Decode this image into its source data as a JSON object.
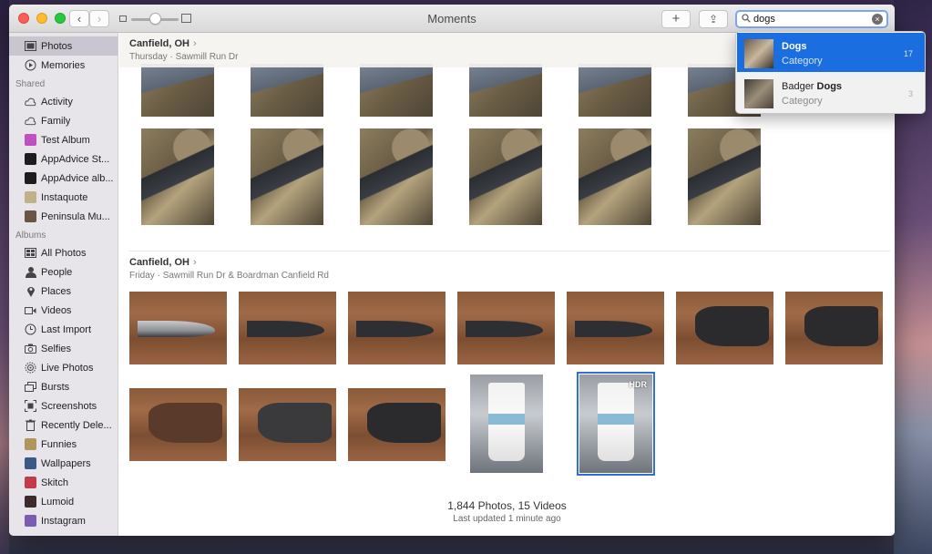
{
  "window": {
    "title": "Moments"
  },
  "toolbar": {
    "back_glyph": "‹",
    "forward_glyph": "›",
    "add_glyph": "+",
    "share_glyph": "⇪"
  },
  "search": {
    "value": "dogs",
    "placeholder": "Search"
  },
  "sidebar": {
    "items": [
      {
        "label": "Photos",
        "icon": "photos-icon",
        "selected": true
      },
      {
        "label": "Memories",
        "icon": "memories-icon"
      }
    ],
    "shared_header": "Shared",
    "shared": [
      {
        "label": "Activity",
        "icon": "cloud-icon"
      },
      {
        "label": "Family",
        "icon": "cloud-icon"
      },
      {
        "label": "Test Album",
        "icon": "album-thumb-icon",
        "color": "#c04fc0"
      },
      {
        "label": "AppAdvice St...",
        "icon": "album-thumb-icon",
        "color": "#1d1d1d"
      },
      {
        "label": "AppAdvice alb...",
        "icon": "album-thumb-icon",
        "color": "#1d1d1d"
      },
      {
        "label": "Instaquote",
        "icon": "album-thumb-icon",
        "color": "#bfb28a"
      },
      {
        "label": "Peninsula Mu...",
        "icon": "album-thumb-icon",
        "color": "#6a5443"
      }
    ],
    "albums_header": "Albums",
    "albums": [
      {
        "label": "All Photos",
        "icon": "all-photos-icon"
      },
      {
        "label": "People",
        "icon": "person-icon"
      },
      {
        "label": "Places",
        "icon": "pin-icon"
      },
      {
        "label": "Videos",
        "icon": "video-icon"
      },
      {
        "label": "Last Import",
        "icon": "clock-icon"
      },
      {
        "label": "Selfies",
        "icon": "camera-icon"
      },
      {
        "label": "Live Photos",
        "icon": "live-icon"
      },
      {
        "label": "Bursts",
        "icon": "burst-icon"
      },
      {
        "label": "Screenshots",
        "icon": "screenshot-icon"
      },
      {
        "label": "Recently Dele...",
        "icon": "trash-icon"
      },
      {
        "label": "Funnies",
        "icon": "album-thumb-icon",
        "color": "#b0955d"
      },
      {
        "label": "Wallpapers",
        "icon": "album-thumb-icon",
        "color": "#3a5a85"
      },
      {
        "label": "Skitch",
        "icon": "album-thumb-icon",
        "color": "#c23b4b"
      },
      {
        "label": "Lumoid",
        "icon": "album-thumb-icon",
        "color": "#3d2a2a"
      },
      {
        "label": "Instagram",
        "icon": "album-thumb-icon",
        "color": "#7a5cb0"
      }
    ]
  },
  "moments": [
    {
      "title": "Canfield, OH",
      "chevron": "›",
      "day": "Thursday",
      "location": "Sawmill Run Dr"
    },
    {
      "title": "Canfield, OH",
      "chevron": "›",
      "day": "Friday",
      "location": "Sawmill Run Dr & Boardman Canfield Rd"
    }
  ],
  "photos": {
    "hdr_badge": "HDR"
  },
  "footer": {
    "count": "1,844 Photos, 15 Videos",
    "updated": "Last updated 1 minute ago"
  },
  "search_results": [
    {
      "title_prefix": "",
      "title_bold": "Dogs",
      "subtitle": "Category",
      "count": "17",
      "active": true
    },
    {
      "title_prefix": "Badger ",
      "title_bold": "Dogs",
      "subtitle": "Category",
      "count": "3",
      "active": false
    }
  ],
  "colors": {
    "accent": "#1a6ee0",
    "sidebar_bg": "#e7e4ea",
    "sidebar_selected": "#cac6cf"
  }
}
